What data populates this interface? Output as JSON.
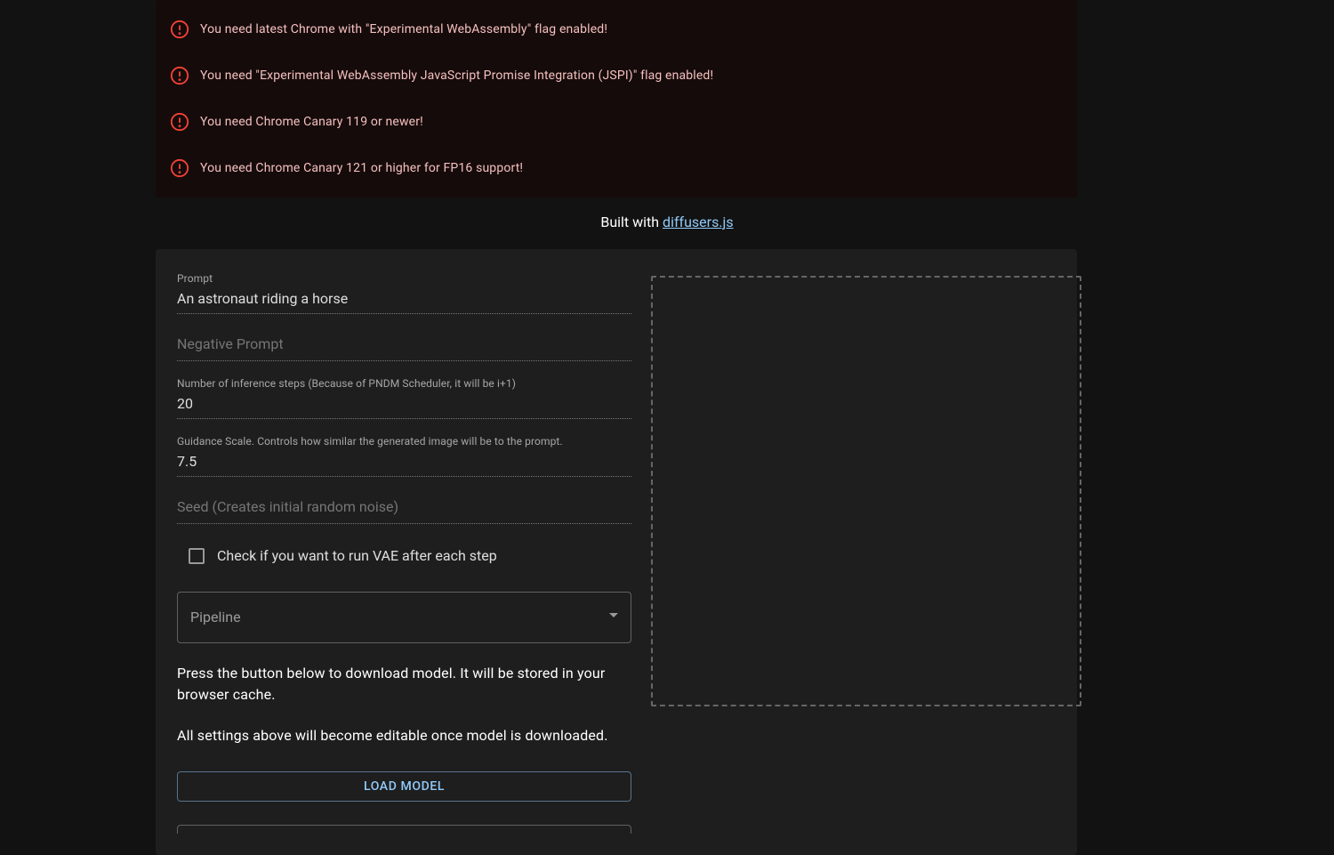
{
  "errors": [
    "You need latest Chrome with \"Experimental WebAssembly\" flag enabled!",
    "You need \"Experimental WebAssembly JavaScript Promise Integration (JSPI)\" flag enabled!",
    "You need Chrome Canary 119 or newer!",
    "You need Chrome Canary 121 or higher for FP16 support!"
  ],
  "built_with": {
    "prefix": "Built with ",
    "link_text": "diffusers.js"
  },
  "form": {
    "prompt": {
      "label": "Prompt",
      "value": "An astronaut riding a horse"
    },
    "negative_prompt": {
      "placeholder": "Negative Prompt",
      "value": ""
    },
    "steps": {
      "label": "Number of inference steps (Because of PNDM Scheduler, it will be i+1)",
      "value": "20"
    },
    "guidance": {
      "label": "Guidance Scale. Controls how similar the generated image will be to the prompt.",
      "value": "7.5"
    },
    "seed": {
      "placeholder": "Seed (Creates initial random noise)",
      "value": ""
    },
    "run_vae_checkbox": {
      "label": "Check if you want to run VAE after each step",
      "checked": false
    },
    "pipeline_select": {
      "placeholder": "Pipeline",
      "value": ""
    },
    "info1": "Press the button below to download model. It will be stored in your browser cache.",
    "info2": "All settings above will become editable once model is downloaded.",
    "load_button": "LOAD MODEL"
  }
}
